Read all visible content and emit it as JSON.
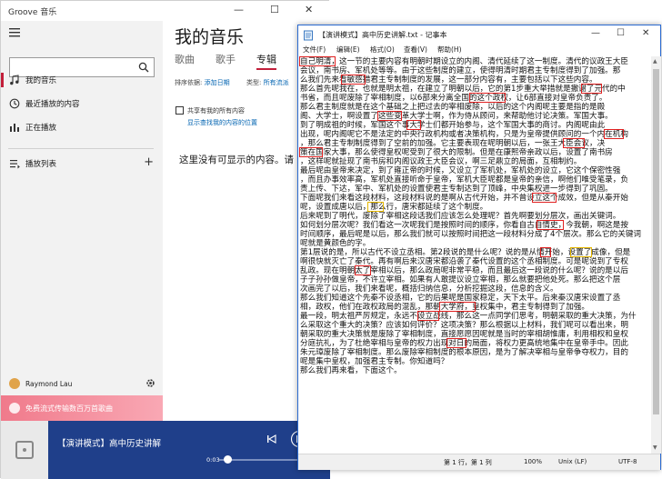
{
  "groove": {
    "app_title": "Groove 音乐",
    "window_controls": [
      "—",
      "☐",
      "✕"
    ],
    "nav": {
      "my_music": "我的音乐",
      "recent": "最近播放的内容",
      "now_playing": "正在播放",
      "playlists": "播放列表",
      "add": "+"
    },
    "page_title": "我的音乐",
    "tabs": [
      "歌曲",
      "歌手",
      "专辑"
    ],
    "sort_label": "排序依据:",
    "sort_value": "添加日期",
    "genre_label": "类型:",
    "genre_value": "所有流派",
    "share_checkbox_label": "共享有我的所有内容",
    "share_link": "显示查找我的内容的位置",
    "empty_message": "这里没有可显示的内容。请",
    "user_name": "Raymond Lau",
    "promo_text": "免费流式传输数百万首歌曲",
    "player": {
      "title": "【演讲模式】高中历史讲解",
      "time": "0:03"
    }
  },
  "notepad": {
    "title": "【演讲模式】高中历史讲解.txt - 记事本",
    "window_controls": [
      "—",
      "☐",
      "✕"
    ],
    "menu": [
      "文件(F)",
      "编辑(E)",
      "格式(O)",
      "查看(V)",
      "帮助(H)"
    ],
    "lines": [
      "自己明清，这一节的主要内容有明朝时期设立的内阁、清代延续了这一制度。清代的议政王大臣",
      "会议，南书房、军机处等等。由于这些制度的建立，使得明清时期君主专制度得到了加强。那",
      "么我们先来看敏感措君主专制制度的发展，这一部分内容有，主要包括以下这些内容。",
      "那么首先呢我在，也就是明太祖，在建立了明朝以后，它的第1步重大举措就是撤谢了元代的中",
      "书省，而且呢废除了宰相制度，以6部来分离全国的这个政权，让6部直接对皇帝负责了。",
      "那么君主制度就是在这个基础之上把过去的宰相废除，以后的这个内阁呢主要是指的是殿",
      "阁、大学士，啊设置了这些变革大学士啊，作为侍从顾问，来帮助他讨论决策。军国大事。",
      "到了明成祖的时候，军国这个事大学士们都开始参与，这个军国大事的商讨。内阁呢由此",
      "出现，呢内阁呢它不是法定的中央行政机构或者决策机构，只是为皇帝提供顾问的一个内在机构",
      "，那么君主专制制度得到了空前的加强。它主要表现在呢明朝以后，一张王大臣会议，决",
      "策在国家大事，那么使得皇权呢受到了很大的限制。但是在康熙帝亲政以后，设置了南书房",
      "，这样呢就扯现了南书房和内阁议政王大臣会议，啊三足鼎立的局面，互相制约。",
      "最后呢由皇帝来决定，到了雍正帝的时候，又设立了军机处，军机处的设立，它这个保密性强",
      "，而且办事效率高，军机处直接听命于皇帝，军机大臣呢都是皇帝的亲信，啊他们唯受笔录，负",
      "责上传、下达，军中、军机处的设置使君主专制达到了顶峰，中央集权进一步得到了巩固。",
      "下面呢我们来看这段材料，这段材料说的是啊从古代开始，并不曾设立这个成效，但是从秦开始",
      "呢，设置成唐以后，那么行，唐宋都延续了这个制度。",
      "后来呢到了明代，废除了宰相这段话我们应该怎么处理呢？首先啊要划分层次，画出关键词。",
      "如何划分层次呢？我们看这一次呢我们是按照时间的顺序，你看自古自情史，今我朝，啊这是按",
      "时间顺序，最后呢是以后，那么我们就可以按照时间把这一段材料分成了4个层次。那么它的关键词",
      "呢就是黄颜色的字。",
      "第1层说的是，所以古代不设立丞相。第2段说的是什么呢？说的是从情开始，设置了成像，但是",
      "啊很快就灭亡了秦代。再有啊后来汉唐宋都沿袭了秦代设置的这个丞相制度。可是呢说到了专权",
      "乱政。现在明朝太了宰相以后，那么政局呢非常平稳，而且最后这一段说的什么呢？说的是以后",
      "子子孙孙做皇帝，不许立宰相。如果有人敢提议设立宰相，那么就要把他处死。那么把这个层",
      "次画完了以后，我们来看呢，概括归纳信息，分析挖掘这段，信息的含义。",
      "那么我们知道这个先秦不设丞相，它的后果呢是国家稳定，天下太平。后来秦汉唐宋设置了丞",
      "相，政权，他们在政权政局的混乱，那朝大学府，皇权集中，君主专制得到了加强。",
      "最一段，明太祖严厉规定，永远不设立战线，那么这一点同学们思考，明朝采取的重大决策，为什",
      "么采取这个重大的决策？应该如何评价？这项决策？那么根据以上材料，我们呢可以看出来，明",
      "朝采取的重大决策就是废除了宰相制度，直接愿愿因呢就是当时的宰相胡惟庸，利用相权和皇权",
      "分庭抗礼，为了杜绝宰相与皇帝的权力出现对日的局面，将权力更高统地集中在皇帝手中。因此",
      "朱元璋废除了宰相制度。那么废除宰相制度的根本原因，是为了解决宰相与皇帝争夺权力，目的",
      "呢是集中皇权，加强君主专制。你知道吗？",
      "那么我们再来看，下面这个。"
    ],
    "status": {
      "position": "第 1 行，第 1 列",
      "zoom": "100%",
      "eol": "Unix (LF)",
      "encoding": "UTF-8"
    }
  }
}
